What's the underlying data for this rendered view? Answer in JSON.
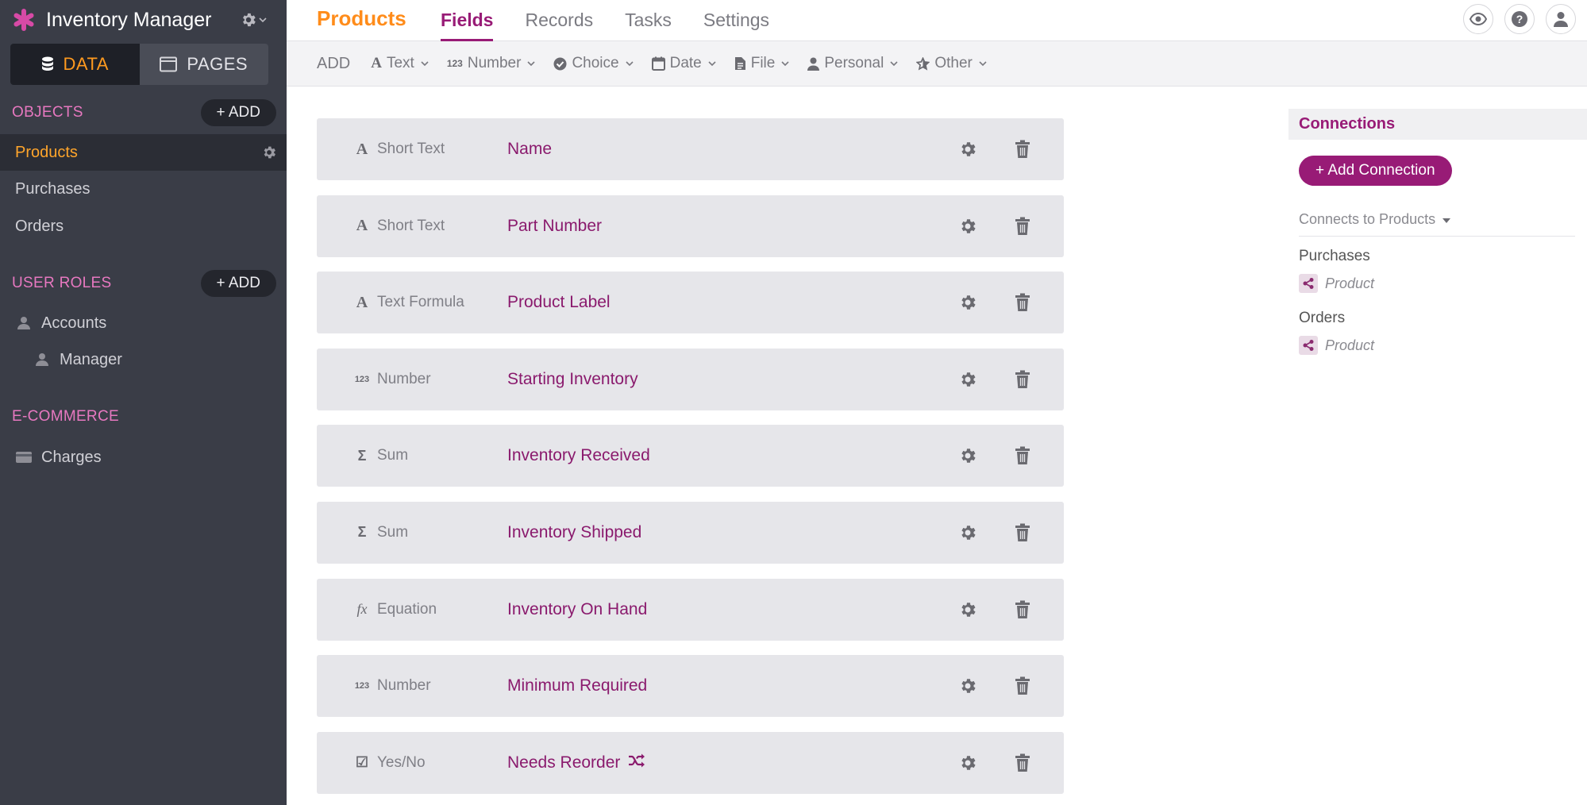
{
  "app": {
    "title": "Inventory Manager",
    "colors": {
      "accent": "#981b76",
      "active_orange": "#ff8c1a",
      "section_pink": "#e778c0",
      "sidebar_bg": "#3a3d47"
    }
  },
  "sidebar": {
    "mode_data": "DATA",
    "mode_pages": "PAGES",
    "objects_label": "OBJECTS",
    "objects_add": "+ ADD",
    "objects": [
      {
        "label": "Products"
      },
      {
        "label": "Purchases"
      },
      {
        "label": "Orders"
      }
    ],
    "roles_label": "USER ROLES",
    "roles_add": "+ ADD",
    "roles": [
      {
        "label": "Accounts"
      },
      {
        "label": "Manager"
      }
    ],
    "ecommerce_label": "E-COMMERCE",
    "ecommerce": [
      {
        "label": "Charges"
      }
    ]
  },
  "header": {
    "object_title": "Products",
    "tabs": [
      {
        "label": "Fields"
      },
      {
        "label": "Records"
      },
      {
        "label": "Tasks"
      },
      {
        "label": "Settings"
      }
    ]
  },
  "addbar": {
    "label": "ADD",
    "types": [
      {
        "label": "Text",
        "icon": "text-icon"
      },
      {
        "label": "Number",
        "icon": "number-icon"
      },
      {
        "label": "Choice",
        "icon": "check-circle-icon"
      },
      {
        "label": "Date",
        "icon": "calendar-icon"
      },
      {
        "label": "File",
        "icon": "file-icon"
      },
      {
        "label": "Personal",
        "icon": "person-icon"
      },
      {
        "label": "Other",
        "icon": "star-icon"
      }
    ]
  },
  "fields": [
    {
      "type_icon": "A",
      "type": "Short Text",
      "name": "Name"
    },
    {
      "type_icon": "A",
      "type": "Short Text",
      "name": "Part Number"
    },
    {
      "type_icon": "A",
      "type": "Text Formula",
      "name": "Product Label"
    },
    {
      "type_icon": "123",
      "type": "Number",
      "name": "Starting Inventory"
    },
    {
      "type_icon": "Σ",
      "type": "Sum",
      "name": "Inventory Received"
    },
    {
      "type_icon": "Σ",
      "type": "Sum",
      "name": "Inventory Shipped"
    },
    {
      "type_icon": "fx",
      "type": "Equation",
      "name": "Inventory On Hand"
    },
    {
      "type_icon": "123",
      "type": "Number",
      "name": "Minimum Required"
    },
    {
      "type_icon": "☑",
      "type": "Yes/No",
      "name": "Needs Reorder"
    }
  ],
  "connections": {
    "title": "Connections",
    "add_label": "+ Add Connection",
    "filter_label": "Connects to Products",
    "groups": [
      {
        "object": "Purchases",
        "field": "Product"
      },
      {
        "object": "Orders",
        "field": "Product"
      }
    ]
  }
}
